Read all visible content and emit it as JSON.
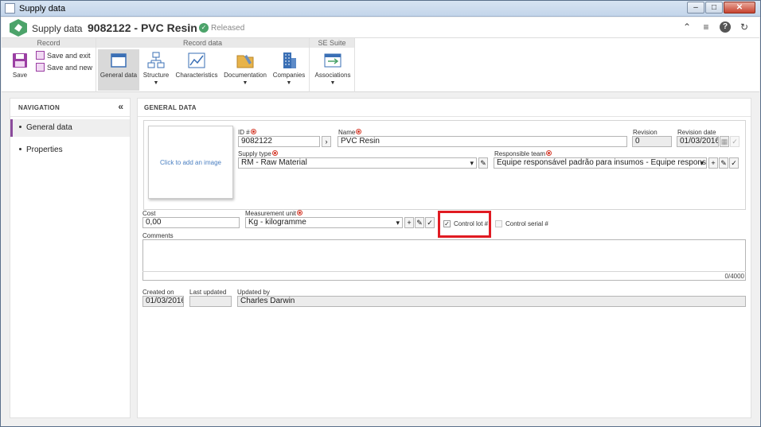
{
  "window": {
    "title": "Supply data",
    "min": "–",
    "max": "□",
    "close": "✕"
  },
  "header": {
    "app_name": "Supply data",
    "separator": "›",
    "record_title": "9082122 - PVC Resin",
    "divider": "|",
    "status": "Released"
  },
  "ribbon": {
    "groups": [
      {
        "title": "Record"
      },
      {
        "title": "Record data"
      },
      {
        "title": "SE Suite"
      }
    ],
    "save": "Save",
    "save_and_exit": "Save and exit",
    "save_and_new": "Save and new",
    "general_data": "General data",
    "structure": "Structure",
    "characteristics": "Characteristics",
    "documentation": "Documentation",
    "companies": "Companies",
    "associations": "Associations",
    "dropdown_glyph": "▼"
  },
  "navigation": {
    "title": "NAVIGATION",
    "collapse": "«",
    "items": [
      {
        "label": "General data",
        "active": true
      },
      {
        "label": "Properties",
        "active": false
      }
    ]
  },
  "main": {
    "title": "GENERAL DATA",
    "image_placeholder": "Click to add an image",
    "id_label": "ID #",
    "id_value": "9082122",
    "name_label": "Name",
    "name_value": "PVC Resin",
    "revision_label": "Revision",
    "revision_value": "0",
    "revision_date_label": "Revision date",
    "revision_date_value": "01/03/2016",
    "supply_type_label": "Supply type",
    "supply_type_value": "RM - Raw Material",
    "responsible_team_label": "Responsible team",
    "responsible_team_value": "Equipe responsável padrão para insumos - Equipe responsáv",
    "cost_label": "Cost",
    "cost_value": "0,00",
    "measurement_unit_label": "Measurement unit",
    "measurement_unit_value": "Kg - kilogramme",
    "control_lot_label": "Control lot #",
    "control_lot_checked": true,
    "control_serial_label": "Control serial #",
    "control_serial_checked": false,
    "comments_label": "Comments",
    "comments_value": "",
    "comments_counter": "0/4000",
    "created_on_label": "Created on",
    "created_on_value": "01/03/2016",
    "last_updated_label": "Last updated",
    "last_updated_value": "",
    "updated_by_label": "Updated by",
    "updated_by_value": "Charles Darwin"
  },
  "colors": {
    "accent": "#8a4a9b",
    "brand_green": "#4ca36a",
    "highlight": "#e01b22",
    "link": "#4a7fc1"
  }
}
